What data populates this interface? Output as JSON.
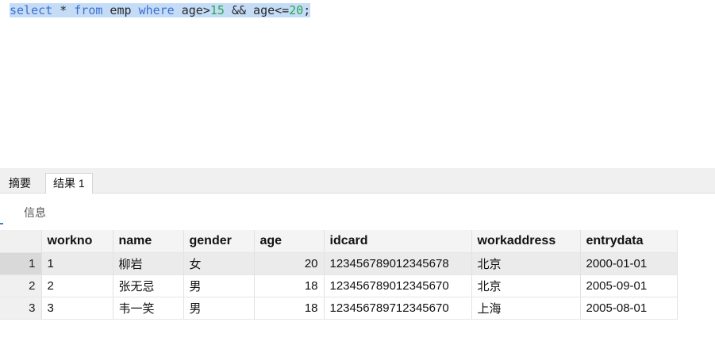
{
  "editor": {
    "tokens": {
      "select": "select",
      "star": " * ",
      "from": "from",
      "table": " emp ",
      "where": "where",
      "col1": " age>",
      "num1": "15",
      "and": " && age<=",
      "num2": "20",
      "semi": ";"
    }
  },
  "tabs": {
    "summary": "摘要",
    "result": "结果 1"
  },
  "info": {
    "label": "信息"
  },
  "grid": {
    "headers": [
      "workno",
      "name",
      "gender",
      "age",
      "idcard",
      "workaddress",
      "entrydata"
    ],
    "rows": [
      {
        "rn": "1",
        "workno": "1",
        "name": "柳岩",
        "gender": "女",
        "age": "20",
        "idcard": "123456789012345678",
        "workaddress": "北京",
        "entrydata": "2000-01-01"
      },
      {
        "rn": "2",
        "workno": "2",
        "name": "张无忌",
        "gender": "男",
        "age": "18",
        "idcard": "123456789012345670",
        "workaddress": "北京",
        "entrydata": "2005-09-01"
      },
      {
        "rn": "3",
        "workno": "3",
        "name": "韦一笑",
        "gender": "男",
        "age": "18",
        "idcard": "123456789712345670",
        "workaddress": "上海",
        "entrydata": "2005-08-01"
      }
    ]
  },
  "colors": {
    "keyword": "#3b6fd1",
    "number": "#27a84a",
    "selection": "#c5dcf7"
  }
}
